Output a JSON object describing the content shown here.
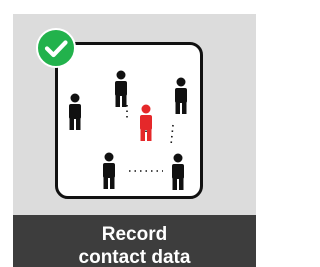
{
  "tile": {
    "label_line1": "Record",
    "label_line2": "contact data",
    "checked": true
  },
  "icons": {
    "badge": "check-circle-icon",
    "people": "person-icon",
    "highlight": "red-person-icon"
  },
  "colors": {
    "tile_background": "#dcdcdc",
    "label_background": "#3d3d3d",
    "label_text": "#ffffff",
    "badge": "#22b24c",
    "person": "#111111",
    "highlighted_person": "#e5282a"
  }
}
